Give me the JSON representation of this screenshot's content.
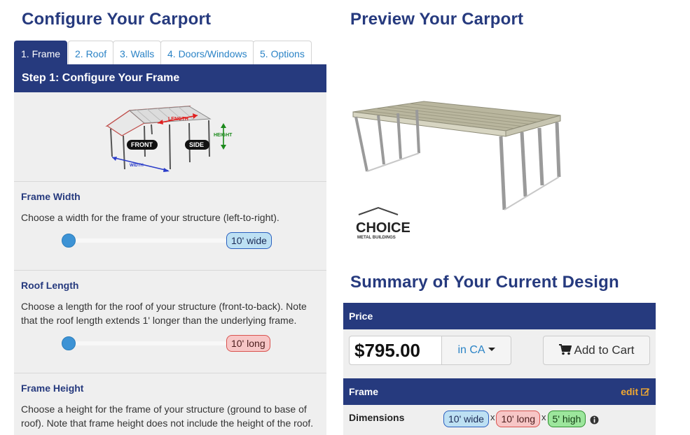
{
  "configure": {
    "title": "Configure Your Carport",
    "tabs": [
      {
        "label": "1. Frame",
        "active": true
      },
      {
        "label": "2. Roof",
        "active": false
      },
      {
        "label": "3. Walls",
        "active": false
      },
      {
        "label": "4. Doors/Windows",
        "active": false
      },
      {
        "label": "5. Options",
        "active": false
      }
    ],
    "step_title": "Step 1: Configure Your Frame",
    "diagram_labels": {
      "length": "LENGTH",
      "height": "HEIGHT",
      "front": "FRONT",
      "side": "SIDE",
      "width": "WIDTH"
    },
    "sections": {
      "width": {
        "title": "Frame Width",
        "description": "Choose a width for the frame of your structure (left-to-right).",
        "value": "10' wide",
        "slider_level": 0
      },
      "length": {
        "title": "Roof Length",
        "description": "Choose a length for the roof of your structure (front-to-back). Note that the roof length extends 1' longer than the underlying frame.",
        "value": "10' long",
        "slider_level": 0
      },
      "height": {
        "title": "Frame Height",
        "description": "Choose a height for the frame of your structure (ground to base of roof). Note that frame height does not include the height of the roof."
      }
    }
  },
  "preview": {
    "title": "Preview Your Carport",
    "logo_text": "CHOICE",
    "logo_subtext": "METAL BUILDINGS"
  },
  "summary": {
    "title": "Summary of Your Current Design",
    "price_label": "Price",
    "price": "$795.00",
    "state_button": "in CA",
    "add_to_cart": "Add to Cart",
    "frame_label": "Frame",
    "edit_label": "edit",
    "dimensions_label": "Dimensions",
    "dim_width": "10' wide",
    "dim_length": "10' long",
    "dim_height": "5' high",
    "separator": "x"
  },
  "colors": {
    "primary": "#263a7e",
    "link": "#2a83c6",
    "edit": "#f0a830",
    "panel": "#efefef"
  },
  "icons": [
    "cart-icon",
    "edit-icon",
    "info-icon",
    "caret-down-icon",
    "slider-handle"
  ]
}
